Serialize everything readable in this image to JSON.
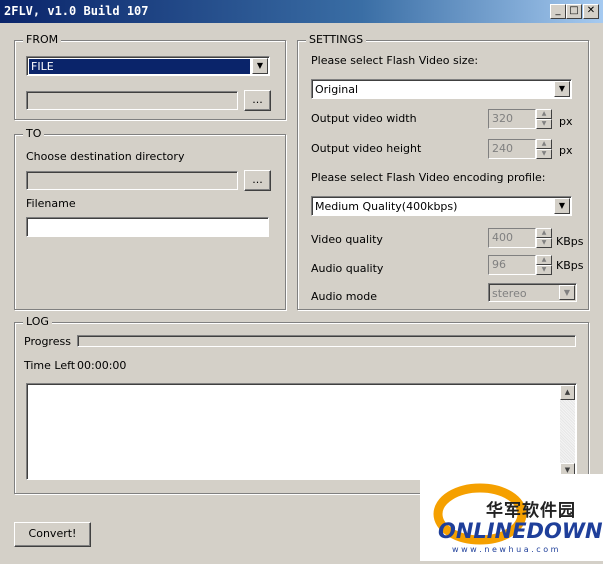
{
  "window": {
    "title": "2FLV, v1.0 Build 107",
    "minimize": "_",
    "maximize": "□",
    "close": "✕"
  },
  "from": {
    "legend": "FROM",
    "source_type": "FILE",
    "path_value": "",
    "browse_label": "..."
  },
  "to": {
    "legend": "TO",
    "dest_label": "Choose destination directory",
    "dest_value": "",
    "browse_label": "...",
    "filename_label": "Filename",
    "filename_value": ""
  },
  "settings": {
    "legend": "SETTINGS",
    "size_label": "Please select Flash Video size:",
    "size_value": "Original",
    "width_label": "Output video width",
    "width_value": "320",
    "height_label": "Output video height",
    "height_value": "240",
    "px": "px",
    "profile_label": "Please select Flash Video encoding profile:",
    "profile_value": "Medium Quality(400kbps)",
    "video_quality_label": "Video quality",
    "video_quality_value": "400",
    "audio_quality_label": "Audio quality",
    "audio_quality_value": "96",
    "kbps": "KBps",
    "audio_mode_label": "Audio mode",
    "audio_mode_value": "stereo"
  },
  "log": {
    "legend": "LOG",
    "progress_label": "Progress",
    "progress": 0,
    "time_left_label": "Time Left",
    "time_left_value": "00:00:00",
    "log_text": ""
  },
  "convert_label": "Convert!",
  "watermark": {
    "cn": "华军软件园",
    "brand": "ONLINEDOWN",
    "url": "w w w . n e w h u a . c o m"
  },
  "colors": {
    "titlebar_start": "#0a246a",
    "face": "#d4d0c8",
    "selection": "#0a246a"
  }
}
